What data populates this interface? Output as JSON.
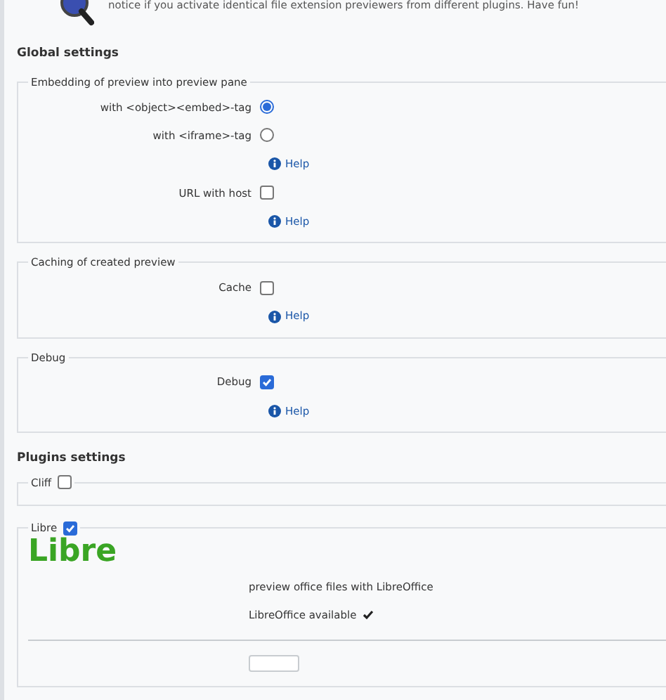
{
  "intro": {
    "text": "notice if you activate identical file extension previewers from different plugins. Have fun!"
  },
  "global_settings": {
    "title": "Global settings",
    "groups": [
      {
        "legend": "Embedding of preview into preview pane",
        "rows": [
          {
            "kind": "radio",
            "label": "with <object><embed>-tag",
            "selected": true
          },
          {
            "kind": "radio",
            "label": "with <iframe>-tag",
            "selected": false
          },
          {
            "kind": "help",
            "label": "Help"
          },
          {
            "kind": "checkbox",
            "label": "URL with host",
            "checked": false
          },
          {
            "kind": "help",
            "label": "Help"
          }
        ]
      },
      {
        "legend": "Caching of created preview",
        "rows": [
          {
            "kind": "checkbox",
            "label": "Cache",
            "checked": false
          },
          {
            "kind": "help",
            "label": "Help"
          }
        ]
      },
      {
        "legend": "Debug",
        "rows": [
          {
            "kind": "checkbox",
            "label": "Debug",
            "checked": true
          },
          {
            "kind": "help",
            "label": "Help"
          }
        ]
      }
    ]
  },
  "plugins_settings": {
    "title": "Plugins settings",
    "plugins": [
      {
        "name": "Cliff",
        "enabled": false
      },
      {
        "name": "Libre",
        "enabled": true,
        "logo": "Libre",
        "description": "preview office files with LibreOffice",
        "status": "LibreOffice available"
      }
    ]
  }
}
